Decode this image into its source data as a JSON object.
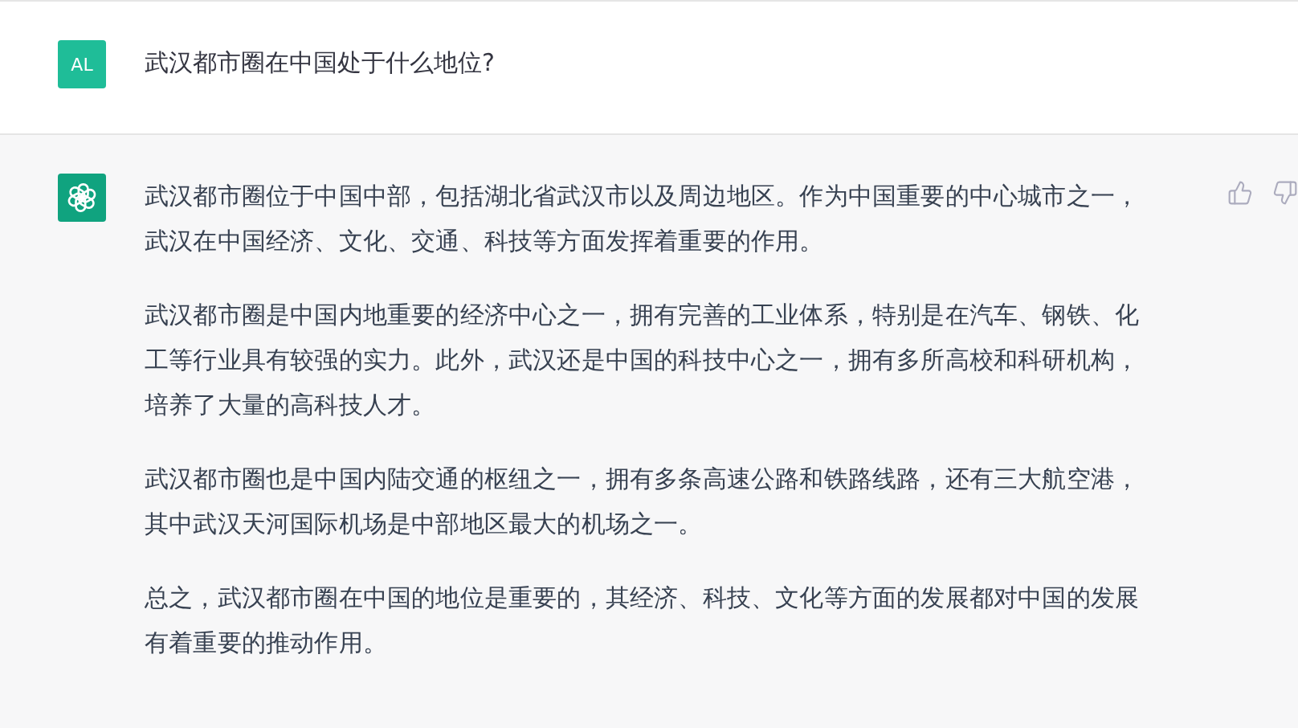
{
  "user_message": {
    "avatar": "AL",
    "text": "武汉都市圈在中国处于什么地位?"
  },
  "assistant_message": {
    "paragraphs": [
      "武汉都市圈位于中国中部，包括湖北省武汉市以及周边地区。作为中国重要的中心城市之一，武汉在中国经济、文化、交通、科技等方面发挥着重要的作用。",
      "武汉都市圈是中国内地重要的经济中心之一，拥有完善的工业体系，特别是在汽车、钢铁、化工等行业具有较强的实力。此外，武汉还是中国的科技中心之一，拥有多所高校和科研机构，培养了大量的高科技人才。",
      "武汉都市圈也是中国内陆交通的枢纽之一，拥有多条高速公路和铁路线路，还有三大航空港，其中武汉天河国际机场是中部地区最大的机场之一。",
      "总之，武汉都市圈在中国的地位是重要的，其经济、科技、文化等方面的发展都对中国的发展有着重要的推动作用。"
    ]
  }
}
